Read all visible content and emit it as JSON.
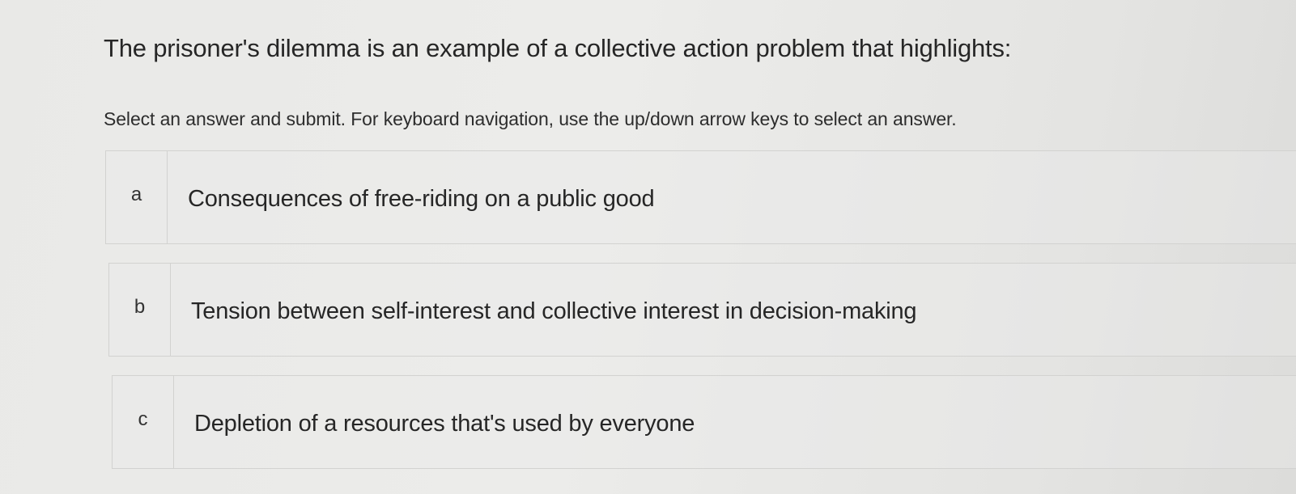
{
  "question": {
    "title": "The prisoner's dilemma is an example of a collective action problem that highlights:",
    "instructions": "Select an answer and submit. For keyboard navigation, use the up/down arrow keys to select an answer."
  },
  "options": [
    {
      "letter": "a",
      "text": "Consequences of free-riding on a public good"
    },
    {
      "letter": "b",
      "text": "Tension between self-interest and collective interest in decision-making"
    },
    {
      "letter": "c",
      "text": "Depletion of a resources that's used by everyone"
    }
  ]
}
